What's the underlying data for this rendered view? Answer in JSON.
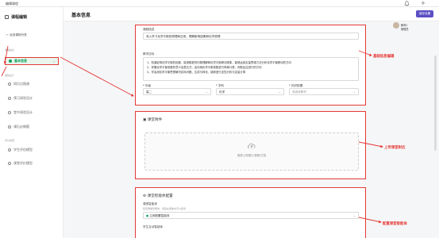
{
  "app": {
    "title": "编辑课程"
  },
  "header": {
    "page_title": "基本信息",
    "save_label": "保存设置"
  },
  "user": {
    "name": "教师1",
    "role": "管理员"
  },
  "sidebar": {
    "title": "课程编辑",
    "back": "← 返回课程列表",
    "groups": [
      "课程信息",
      "课前设计",
      "评价模型"
    ],
    "items": [
      {
        "label": "基本信息"
      },
      {
        "label": "知识点图谱"
      },
      {
        "label": "预习测验设计"
      },
      {
        "label": "堂中测验设计"
      },
      {
        "label": "课后必做题"
      },
      {
        "label": "学生评估模型"
      },
      {
        "label": "课堂评价模型"
      }
    ]
  },
  "form": {
    "desc_label": "课程描述",
    "desc_value": "深入学习化学平衡的原理和应用，理解影响因素和化学原理",
    "goal_label": "教学目标",
    "goal_lines": [
      "1、知道影响化学平衡的因素，能用勒夏特列原理解释化学平衡移动现象，能够运用定量思维方法分析化学平衡移动的方向",
      "2、掌握化学平衡常数的意义及表达式，会利用化学平衡常数进行简单计算，判断反应进行的方向",
      "3、学会用化学平衡思想解决实际问题，生成与转化，能够进行定性分析与定量计算"
    ],
    "grade_label": "* 年级",
    "grade_value": "高二",
    "subject_label": "* 学科",
    "subject_value": "化学",
    "material_label": "* 知识配置",
    "material_value": "请选择教材"
  },
  "attach": {
    "title": "课堂附件",
    "upload_text": "拖拽上传图片/视频/文档"
  },
  "entity": {
    "title": "课堂智能体配置",
    "agent_label": "课堂智能体",
    "agent_hint": "配置课堂智能体，使其在课堂中可以使用",
    "agent_value": "立即配置智能体",
    "bottom_label": "学生互动智能体"
  },
  "annotations": {
    "a1": "基础信息编辑",
    "a2": "上传课堂附近",
    "a3": "配置课堂智能体"
  },
  "colors": {
    "accent": "#5b4fc4",
    "active": "#13a05a",
    "annotation": "#e53935"
  }
}
